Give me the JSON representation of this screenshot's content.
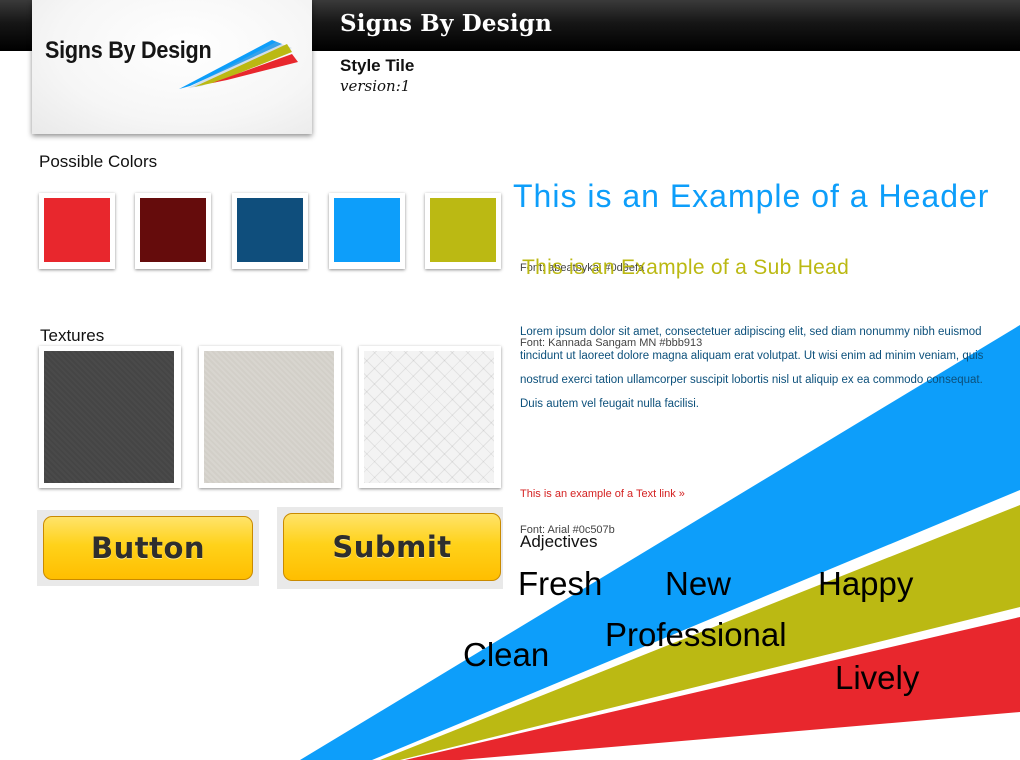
{
  "app": {
    "brand_title": "Signs By Design",
    "logo_text": "Signs By Design",
    "style_tile_title": "Style Tile",
    "version_label": "version:1"
  },
  "colors_section": {
    "label": "Possible Colors",
    "swatches": [
      "#e8272d",
      "#650c0c",
      "#0f4e7c",
      "#0d9efa",
      "#bbb913"
    ]
  },
  "textures_section": {
    "label": "Textures",
    "items": [
      "dark-grey-texture",
      "beige-texture",
      "light-diamond-texture"
    ]
  },
  "buttons": {
    "button_label": "Button",
    "submit_label": "Submit"
  },
  "typography": {
    "header_example": "This is an Example of a Header",
    "header_font_note": "Font: abeatbykai  #0d9efa",
    "subhead_example": "This is an Example of a Sub Head",
    "subhead_font_note": "Font: Kannada Sangam MN  #bbb913",
    "body_copy": "Lorem ipsum dolor sit amet, consectetuer adipiscing elit, sed diam nonummy nibh euismod tincidunt ut laoreet dolore magna aliquam erat volutpat. Ut wisi enim ad minim veniam, quis nostrud exerci tation ullamcorper suscipit lobortis nisl ut aliquip ex ea commodo consequat. Duis autem vel feugait nulla facilisi.",
    "body_font_note": "Font: Arial  #0c507b",
    "text_link": "This is an example of a Text link »"
  },
  "adjectives_section": {
    "label": "Adjectives",
    "words": [
      "Fresh",
      "New",
      "Happy",
      "Professional",
      "Clean",
      "Lively"
    ]
  },
  "stripe_colors": {
    "blue": "#0d9efa",
    "olive": "#bbb913",
    "red": "#e8272d"
  }
}
